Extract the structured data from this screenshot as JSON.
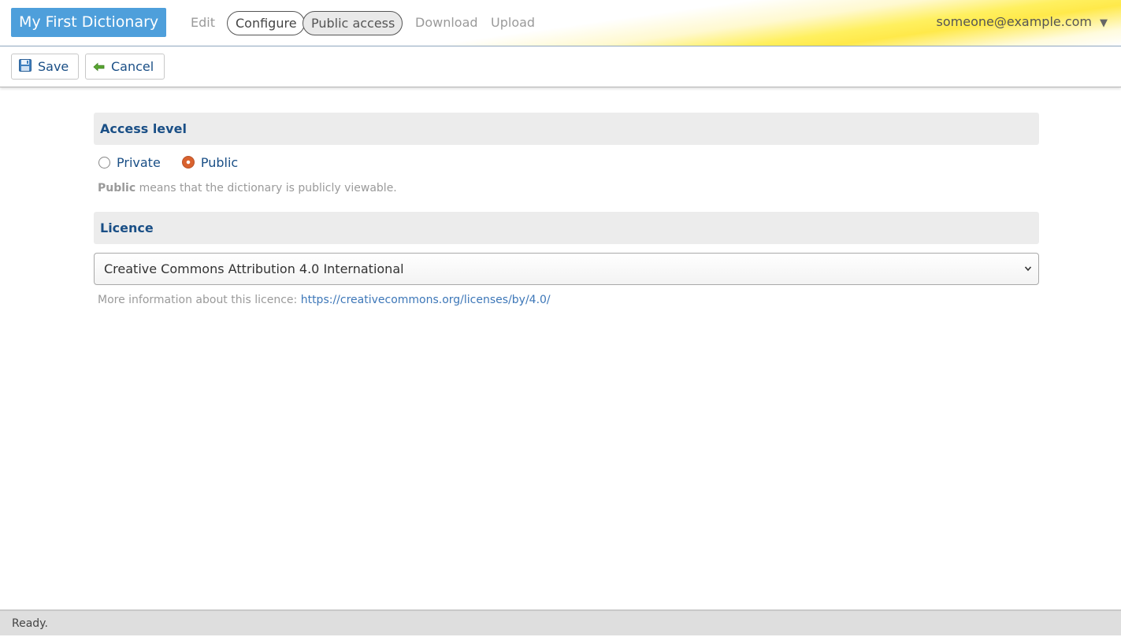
{
  "header": {
    "dictionary_title": "My First Dictionary",
    "nav": {
      "edit": "Edit",
      "configure": "Configure",
      "public_access": "Public access",
      "download": "Download",
      "upload": "Upload"
    },
    "user_email": "someone@example.com",
    "user_caret": "▼"
  },
  "toolbar": {
    "save_label": "Save",
    "cancel_label": "Cancel"
  },
  "access": {
    "heading": "Access level",
    "options": {
      "private": "Private",
      "public": "Public"
    },
    "selected": "public",
    "hint_strong": "Public",
    "hint_text": " means that the dictionary is publicly viewable."
  },
  "licence": {
    "heading": "Licence",
    "selected_option": "Creative Commons Attribution 4.0 International",
    "more_info_label": "More information about this licence:",
    "more_info_url": "https://creativecommons.org/licenses/by/4.0/"
  },
  "status": {
    "text": "Ready."
  },
  "colors": {
    "title_bg": "#4e9fdb",
    "accent_text": "#1a4f86",
    "link": "#3d77b8",
    "radio_checked": "#d9622e"
  }
}
